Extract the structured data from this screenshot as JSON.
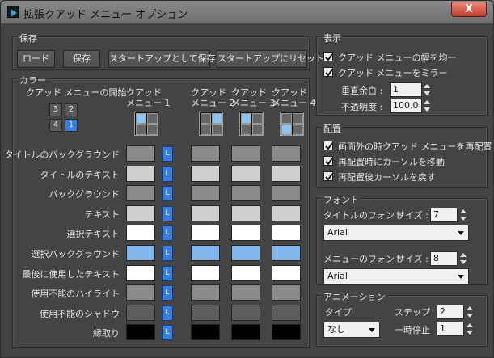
{
  "window": {
    "title": "拡張クアッド メニュー オプション",
    "close_glyph": "X"
  },
  "save_group": {
    "label": "保存",
    "buttons": [
      "ロード",
      "保存",
      "スタートアップとして保存",
      "スタートアップにリセット"
    ]
  },
  "color_group": {
    "label": "カラー",
    "start_label": "クアッド メニューの開始",
    "quad_numbers": [
      "3",
      "2",
      "4",
      "1"
    ],
    "menu_headers": [
      {
        "line1": "クアッド",
        "line2": "メニュー 1"
      },
      {
        "line1": "クアッド",
        "line2": "メニュー 2"
      },
      {
        "line1": "クアッド",
        "line2": "メニュー 3"
      },
      {
        "line1": "クアッド",
        "line2": "メニュー 4"
      }
    ],
    "lock_label": "L",
    "rows": [
      {
        "label": "タイトルのバックグラウンド",
        "color": "#8a8a8a"
      },
      {
        "label": "タイトルのテキスト",
        "color": "#cfcfcf"
      },
      {
        "label": "バックグラウンド",
        "color": "#8a8a8a"
      },
      {
        "label": "テキスト",
        "color": "#cfcfcf"
      },
      {
        "label": "選択テキスト",
        "color": "#ffffff"
      },
      {
        "label": "選択バックグラウンド",
        "color": "#7fb7ee"
      },
      {
        "label": "最後に使用したテキスト",
        "color": "#ffffff"
      },
      {
        "label": "使用不能のハイライト",
        "color": "#8a8a8a"
      },
      {
        "label": "使用不能のシャドウ",
        "color": "#5e5e5e"
      },
      {
        "label": "縁取り",
        "color": "#000000"
      }
    ]
  },
  "display_group": {
    "label": "表示",
    "checks": [
      "クアッド メニューの幅を均一",
      "クアッド メニューをミラー"
    ],
    "vmargin_label": "垂直余白 :",
    "vmargin_value": "1",
    "opacity_label": "不透明度 :",
    "opacity_value": "100.0"
  },
  "placement_group": {
    "label": "配置",
    "checks": [
      "画面外の時クアッド メニューを再配置",
      "再配置時にカーソルを移動",
      "再配置後カーソルを戻す"
    ]
  },
  "font_group": {
    "label": "フォント",
    "title_font_label": "タイトルのフォント",
    "size_label": "サイズ :",
    "title_size": "7",
    "title_font": "Arial",
    "menu_font_label": "メニューのフォント",
    "menu_size": "8",
    "menu_font": "Arial"
  },
  "anim_group": {
    "label": "アニメーション",
    "type_label": "タイプ",
    "type_value": "なし",
    "step_label": "ステップ",
    "step_value": "2",
    "pause_label": "一時停止",
    "pause_value": "1"
  },
  "colors": {
    "accent": "#3a7de0",
    "dialog_bg": "#444444"
  }
}
